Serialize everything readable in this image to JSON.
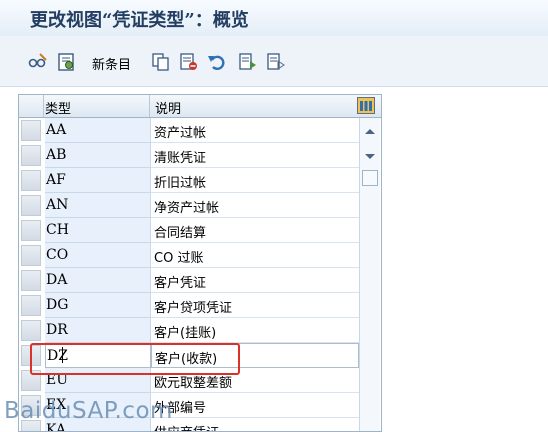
{
  "window": {
    "title": "更改视图“凭证类型”：概览"
  },
  "toolbar": {
    "new_entries_label": "新条目",
    "icons": [
      "glasses-pencil-icon",
      "details-icon",
      "copy-icon",
      "delete-icon",
      "undo-icon",
      "select-all-icon",
      "deselect-all-icon"
    ]
  },
  "table": {
    "columns": [
      "类型",
      "说明"
    ],
    "rows": [
      {
        "key": "AA",
        "desc": "资产过帐"
      },
      {
        "key": "AB",
        "desc": "清账凭证"
      },
      {
        "key": "AF",
        "desc": "折旧过帐"
      },
      {
        "key": "AN",
        "desc": "净资产过帐"
      },
      {
        "key": "CH",
        "desc": "合同结算"
      },
      {
        "key": "CO",
        "desc": "CO 过账"
      },
      {
        "key": "DA",
        "desc": "客户凭证"
      },
      {
        "key": "DG",
        "desc": "客户贷项凭证"
      },
      {
        "key": "DR",
        "desc": "客户(挂账)"
      },
      {
        "key": "DZ",
        "desc": "客户(收款)"
      },
      {
        "key": "EU",
        "desc": "欧元取整差额"
      },
      {
        "key": "EX",
        "desc": "外部编号"
      },
      {
        "key": "KA",
        "desc": "供应商凭证"
      }
    ]
  },
  "watermark": "BaiduSAP.com",
  "colors": {
    "highlight_box": "#d9322b",
    "title": "#243e62",
    "key_column_bg": "#e8f1fb"
  }
}
